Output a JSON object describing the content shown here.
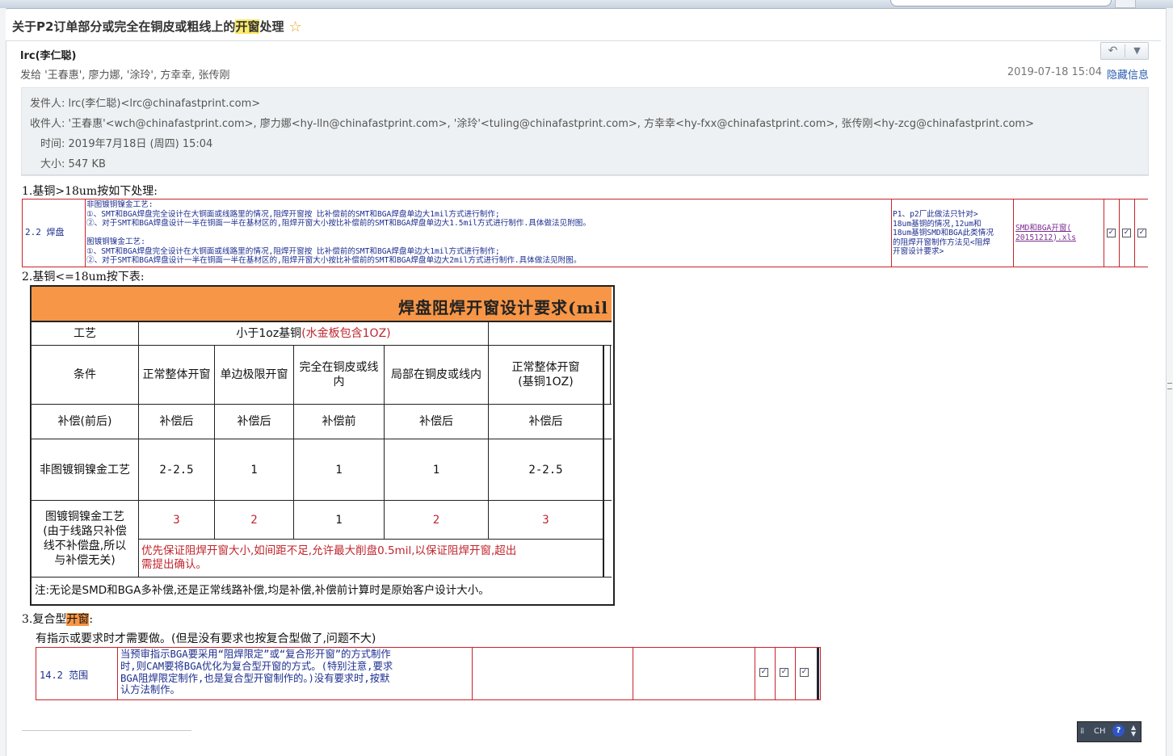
{
  "window": {
    "subject_before": "关于P2订单部分或完全在铜皮或粗线上的",
    "subject_highlight": "开窗",
    "subject_after": "处理",
    "star_icon": "star-icon"
  },
  "header": {
    "sender": "lrc(李仁聪)",
    "send_to": "发给 '王春惠', 廖力娜, '涂玲', 方幸幸, 张传刚",
    "date": "2019-07-18 15:04",
    "hide_info": "隐藏信息",
    "reply_icon": "reply-icon",
    "more_icon": "chevron-down-icon"
  },
  "details": {
    "from": "发件人: lrc(李仁聪)<lrc@chinafastprint.com>",
    "to": "收件人: '王春惠'<wch@chinafastprint.com>, 廖力娜<hy-lln@chinafastprint.com>, '涂玲'<tuling@chinafastprint.com>, 方幸幸<hy-fxx@chinafastprint.com>, 张传刚<hy-zcg@chinafastprint.com>",
    "time": "时间: 2019年7月18日 (周四) 15:04",
    "size": "大小: 547 KB"
  },
  "body": {
    "sec1": "1.基铜>18um按如下处理:",
    "t1_id": "2.2 焊盘",
    "t1_text": "非图镀铜镍金工艺:\n①、SMT和BGA焊盘完全设计在大铜面或线路里的情况,阻焊开窗按 比补偿前的SMT和BGA焊盘单边大1mil方式进行制作;\n②、对于SMT和BGA焊盘设计一半在铜面一半在基材区的,阻焊开窗大小按比补偿前的SMT和BGA焊盘单边大1.5mil方式进行制作.具体做法见附图。\n\n图镀铜镍金工艺:\n①、SMT和BGA焊盘完全设计在大铜面或线路里的情况,阻焊开窗按 比补偿前的SMT和BGA焊盘单边大1mil方式进行制作;\n②、对于SMT和BGA焊盘设计一半在铜面一半在基材区的,阻焊开窗大小按比补偿前的SMT和BGA焊盘单边大2mil方式进行制作.具体做法见附图。",
    "t1_note": "P1、p2厂此做法只针对>\n18um基铜的情况,12um和\n18um基铜SMD和BGA此类情况\n的阻焊开窗制作方法见<阻焊\n开窗设计要求>",
    "t1_link": "SMD和BGA开窗(\n20151212).xls",
    "sec2": "2.基铜<=18um按下表:",
    "sec3_before": "3.复合型",
    "sec3_highlight": "开窗",
    "sec3_after": ":",
    "sec3_desc": "有指示或要求时才需要做。(但是没有要求也按复合型做了,问题不大)",
    "t3_id": "14.2 范围",
    "t3_text": "当预审指示BGA要采用“阻焊限定”或“复合形开窗”的方式制作\n时,则CAM要将BGA优化为复合型开窗的方式。(特别注意,要求\nBGA阻焊限定制作,也是复合型开窗制作的。)没有要求时,按默\n认方法制作。"
  },
  "table2": {
    "title": "焊盘阻焊开窗设计要求(mil",
    "r1": {
      "c0": "工艺",
      "c1": "小于1oz基铜",
      "c1_red": "(水金板包含1OZ)"
    },
    "r2": [
      "条件",
      "正常整体开窗",
      "单边极限开窗",
      "完全在铜皮或线内",
      "局部在铜皮或线内",
      "正常整体开窗\n(基铜1OZ)"
    ],
    "r3": [
      "补偿(前后)",
      "补偿后",
      "补偿后",
      "补偿前",
      "补偿后",
      "补偿后"
    ],
    "r4": [
      "非图镀铜镍金工艺",
      "2-2.5",
      "1",
      "1",
      "1",
      "2-2.5"
    ],
    "r5": [
      "图镀铜镍金工艺\n(由于线路只补偿\n线不补偿盘,所以\n与补偿无关)",
      "3",
      "2",
      "1",
      "2",
      "3"
    ],
    "r5_note": "优先保证阻焊开窗大小,如间距不足,允许最大削盘0.5mil,以保证阻焊开窗,超出\n需提出确认。",
    "note": "注:无论是SMD和BGA多补偿,还是正常线路补偿,均是补偿,补偿前计算时是原始客户设计大小。"
  },
  "ime": {
    "label": "CH",
    "help": "?"
  }
}
